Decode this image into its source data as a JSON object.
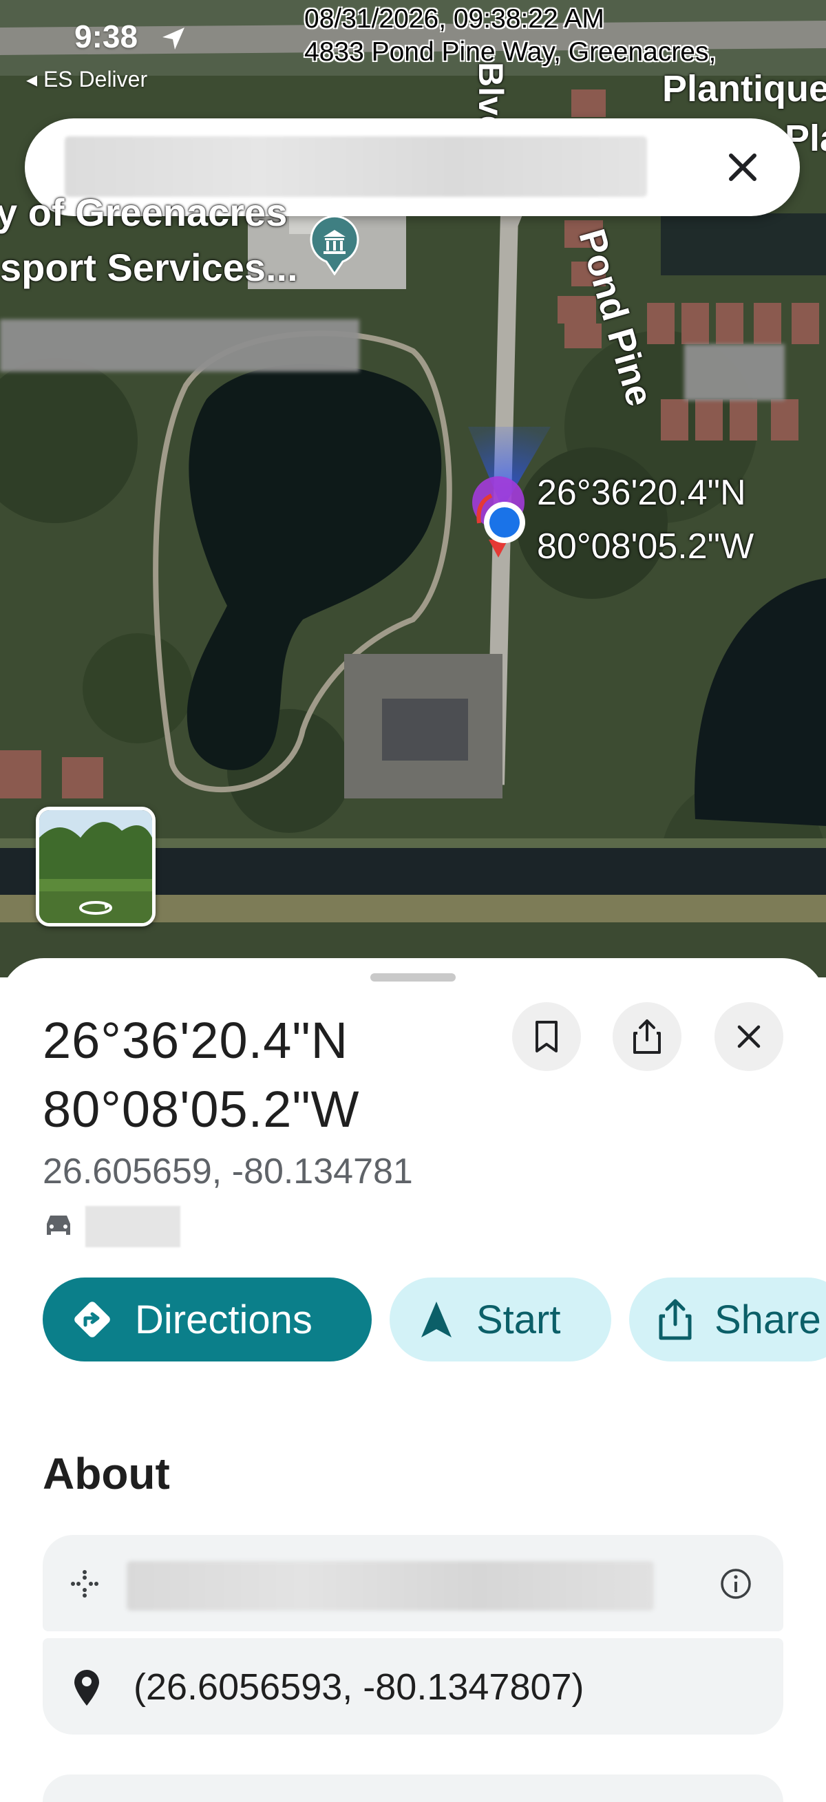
{
  "status_bar": {
    "time": "9:38",
    "back_label": "◂ ES Deliver"
  },
  "photo_stamp": {
    "datetime": "08/31/2026, 09:38:22 AM",
    "address": "4833 Pond Pine Way, Greenacres,"
  },
  "map": {
    "labels": {
      "blvd": "Blvd",
      "plantique": "Plantique",
      "pla": "Pla",
      "place_line1": "y of Greenacres",
      "place_line2": "sport Services...",
      "pond_pine": "Pond Pine"
    },
    "pin_coords": {
      "lat": "26°36'20.4\"N",
      "lon": "80°08'05.2\"W"
    }
  },
  "place": {
    "title_lat": "26°36'20.4\"N",
    "title_lon": "80°08'05.2\"W",
    "decimal": "26.605659, -80.134781"
  },
  "actions": {
    "directions": "Directions",
    "start": "Start",
    "share": "Share"
  },
  "about": {
    "heading": "About",
    "plus_code_coords": "(26.6056593, -80.1347807)"
  },
  "colors": {
    "primary": "#0b7f8a",
    "secondary_bg": "#d3f2f7",
    "secondary_text": "#0b5f68",
    "pin_purple": "#a23bd9",
    "location_blue": "#1a73e8"
  }
}
